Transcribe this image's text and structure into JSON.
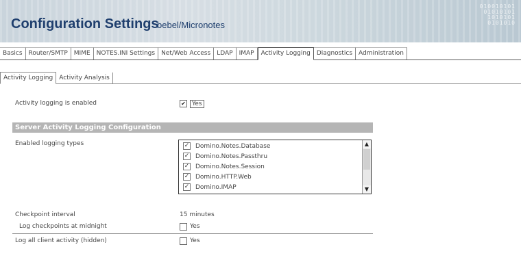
{
  "header": {
    "title": "Configuration Settings",
    "server": "bebel/Micronotes",
    "binary_lines": [
      "010010101",
      "01010101",
      "1010101",
      "0101010"
    ]
  },
  "tabs": [
    {
      "label": "Basics"
    },
    {
      "label": "Router/SMTP"
    },
    {
      "label": "MIME"
    },
    {
      "label": "NOTES.INI Settings"
    },
    {
      "label": "Net/Web Access"
    },
    {
      "label": "LDAP"
    },
    {
      "label": "IMAP"
    },
    {
      "label": "Activity Logging",
      "active": true
    },
    {
      "label": "Diagnostics"
    },
    {
      "label": "Administration"
    }
  ],
  "subtabs": [
    {
      "label": "Activity Logging",
      "active": true
    },
    {
      "label": "Activity Analysis"
    }
  ],
  "form": {
    "enabled_label": "Activity logging is enabled",
    "enabled_value": "Yes",
    "enabled_checked": true,
    "section_title": "Server Activity Logging Configuration",
    "logging_types_label": "Enabled logging types",
    "logging_types": [
      {
        "label": "Domino.Notes.Database",
        "checked": true
      },
      {
        "label": "Domino.Notes.Passthru",
        "checked": true
      },
      {
        "label": "Domino.Notes.Session",
        "checked": true
      },
      {
        "label": "Domino.HTTP.Web",
        "checked": true
      },
      {
        "label": "Domino.IMAP",
        "checked": true
      }
    ],
    "checkpoint_label": "Checkpoint interval",
    "checkpoint_value": "15 minutes",
    "checkpoint_start_label": "Log checkpoints at midnight",
    "checkpoint_start_value": "Yes",
    "checkpoint_start_checked": false,
    "log_label": "Log all client activity (hidden)",
    "log_value": "Yes",
    "log_checked": false
  }
}
